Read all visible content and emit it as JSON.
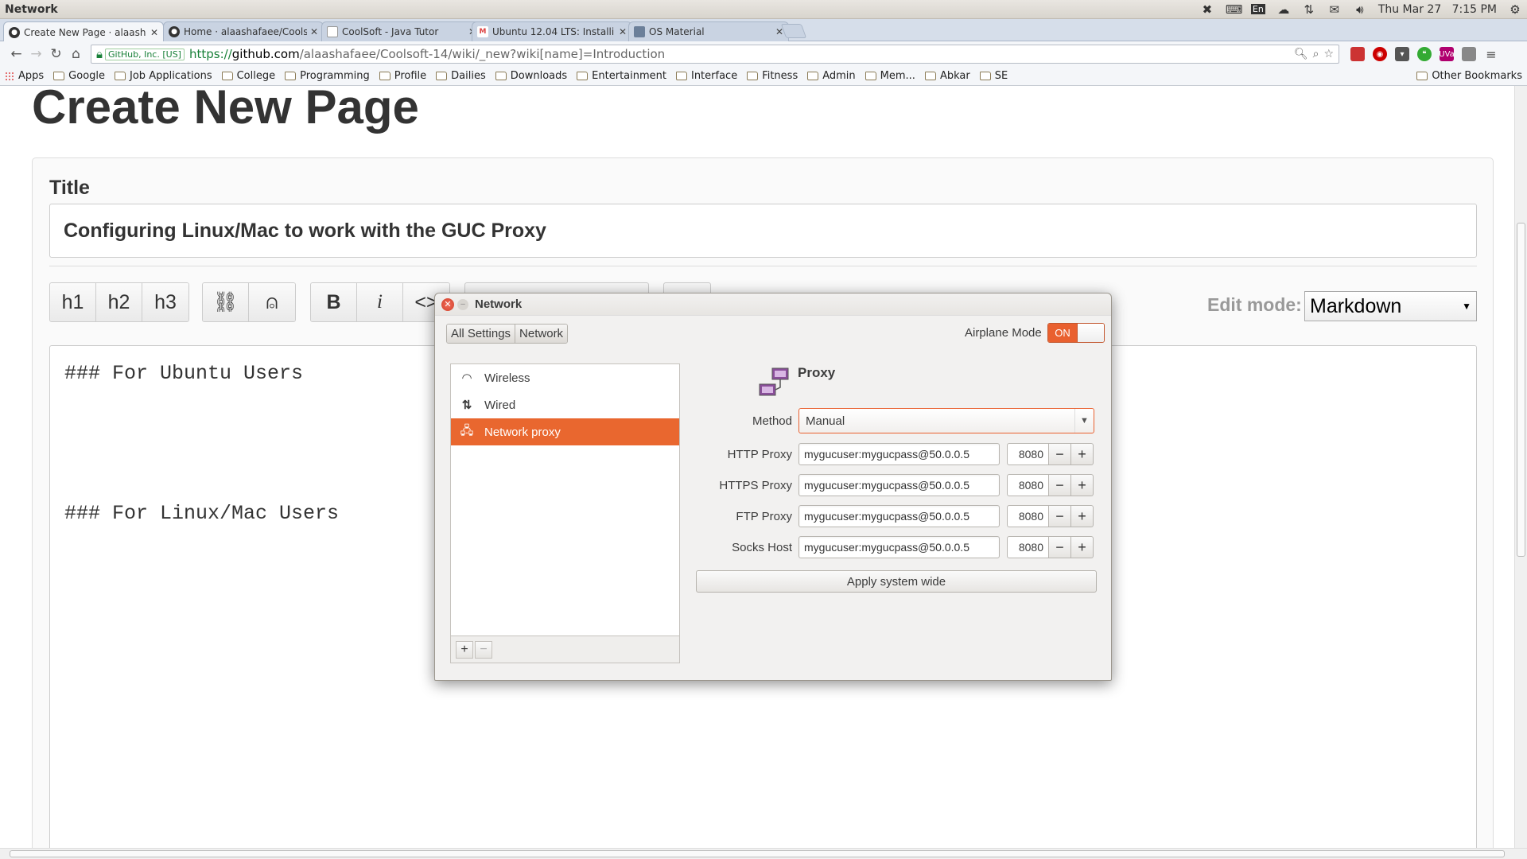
{
  "topbar": {
    "title": "Network",
    "clock": "Thu Mar 27   7:15 PM",
    "keyboard_layout": "En",
    "tray_icons": [
      "dropbox-icon",
      "keyboard-icon",
      "keyboard-layout-indicator",
      "cloud-icon",
      "network-icon",
      "mail-icon",
      "volume-icon"
    ]
  },
  "tabs": [
    {
      "label": "Create New Page · alaash",
      "icon": "github-icon",
      "active": true
    },
    {
      "label": "Home · alaashafaee/Cools",
      "icon": "github-icon",
      "active": false
    },
    {
      "label": "CoolSoft - Java Tutor",
      "icon": "document-icon",
      "active": false
    },
    {
      "label": "Ubuntu 12.04 LTS: Installi",
      "icon": "gmail-icon",
      "active": false
    },
    {
      "label": "OS Material",
      "icon": "document-icon",
      "active": false
    }
  ],
  "toolbar": {
    "ev_badge": "GitHub, Inc. [US]",
    "url_scheme": "https://",
    "url_host": "github.com",
    "url_path": "/alaashafaee/Coolsoft-14/wiki/_new?wiki[name]=Introduction",
    "extensions": {
      "uva": "UVa"
    }
  },
  "bookmarks": {
    "apps": "Apps",
    "folders": [
      "Google",
      "Job Applications",
      "College",
      "Programming",
      "Profile",
      "Dailies",
      "Downloads",
      "Entertainment",
      "Interface",
      "Fitness",
      "Admin",
      "Mem...",
      "Abkar",
      "SE"
    ],
    "other": "Other Bookmarks"
  },
  "page": {
    "heading": "Create New Page",
    "title_label": "Title",
    "title_value": "Configuring Linux/Mac to work with the GUC Proxy",
    "format_buttons": {
      "h1": "h1",
      "h2": "h2",
      "h3": "h3",
      "bold": "B",
      "italic": "i",
      "code": "<>"
    },
    "edit_mode_label": "Edit mode:",
    "edit_mode_value": "Markdown",
    "editor_lines": [
      "### For Ubuntu Users",
      "### For Linux/Mac Users"
    ]
  },
  "dialog": {
    "title": "Network",
    "nav": [
      "All Settings",
      "Network"
    ],
    "airplane_label": "Airplane Mode",
    "airplane_state": "ON",
    "devices": [
      {
        "label": "Wireless",
        "icon": "wifi-icon",
        "selected": false
      },
      {
        "label": "Wired",
        "icon": "wired-arrows-icon",
        "selected": false
      },
      {
        "label": "Network proxy",
        "icon": "network-proxy-icon",
        "selected": true
      }
    ],
    "proxy_heading": "Proxy",
    "method_label": "Method",
    "method_value": "Manual",
    "proxies": [
      {
        "label": "HTTP Proxy",
        "value": "mygucuser:mygucpass@50.0.0.5",
        "port": "8080"
      },
      {
        "label": "HTTPS Proxy",
        "value": "mygucuser:mygucpass@50.0.0.5",
        "port": "8080"
      },
      {
        "label": "FTP Proxy",
        "value": "mygucuser:mygucpass@50.0.0.5",
        "port": "8080"
      },
      {
        "label": "Socks Host",
        "value": "mygucuser:mygucpass@50.0.0.5",
        "port": "8080"
      }
    ],
    "apply_label": "Apply system wide",
    "accent": "#e9672f"
  }
}
